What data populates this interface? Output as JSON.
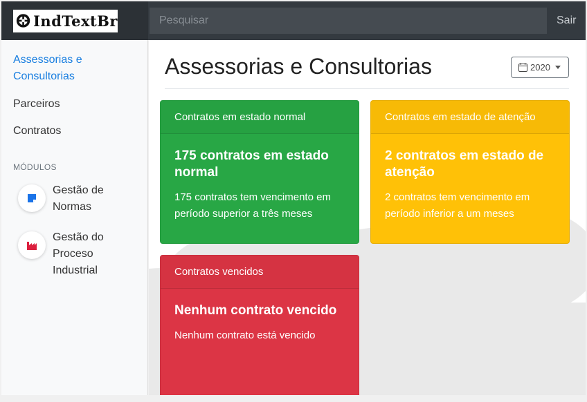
{
  "brand": {
    "name": "IndTextBr"
  },
  "search": {
    "placeholder": "Pesquisar"
  },
  "nav": {
    "signout": "Sair"
  },
  "sidebar": {
    "items": [
      {
        "label": "Assessorias e Consultorias",
        "active": true
      },
      {
        "label": "Parceiros",
        "active": false
      },
      {
        "label": "Contratos",
        "active": false
      }
    ],
    "modules_heading": "MÓDULOS",
    "modules": [
      {
        "label": "Gestão de Normas",
        "icon": "blue-note-icon",
        "color": "#1a73e8"
      },
      {
        "label": "Gestão do Proceso Industrial",
        "icon": "factory-icon",
        "color": "#dc1f3e"
      }
    ]
  },
  "main": {
    "title": "Assessorias e Consultorias",
    "year": "2020",
    "cards": [
      {
        "header": "Contratos em estado normal",
        "title": "175 contratos em estado normal",
        "text": "175 contratos tem vencimento em período superior a três meses",
        "color": "#28a745"
      },
      {
        "header": "Contratos em estado de atenção",
        "title": "2 contratos em estado de atenção",
        "text": "2 contratos tem vencimento em período inferior a um meses",
        "color": "#ffc107"
      },
      {
        "header": "Contratos vencidos",
        "title": "Nenhum contrato vencido",
        "text": "Nenhum contrato está vencido",
        "color": "#dc3545"
      }
    ]
  }
}
